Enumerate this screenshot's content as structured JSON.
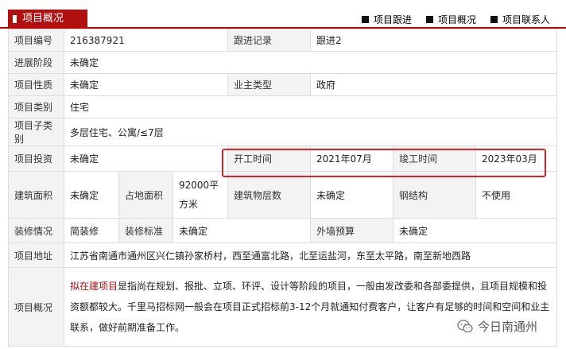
{
  "header": {
    "title": "项目概况",
    "nav": [
      "项目跟进",
      "项目概况",
      "项目联系人"
    ]
  },
  "rows": {
    "code_label": "项目编号",
    "code_value": "216387921",
    "follow_label": "跟进记录",
    "follow_value": "跟进2",
    "stage_label": "进展阶段",
    "stage_value": "未确定",
    "nature_label": "项目性质",
    "nature_value": "未确定",
    "owner_type_label": "业主类型",
    "owner_type_value": "政府",
    "category_label": "项目类别",
    "category_value": "住宅",
    "subcategory_label": "项目子类别",
    "subcategory_value": "多层住宅、公寓/≤7层",
    "investment_label": "项目投资",
    "investment_value": "未确定",
    "start_label": "开工时间",
    "start_value": "2021年07月",
    "finish_label": "竣工时间",
    "finish_value": "2023年03月",
    "building_area_label": "建筑面积",
    "building_area_value": "未确定",
    "land_area_label": "占地面积",
    "land_area_value": "92000平方米",
    "floors_label": "建筑物层数",
    "floors_value": "未确定",
    "steel_label": "钢结构",
    "steel_value": "不使用",
    "decor_label": "装修情况",
    "decor_value": "简装修",
    "decor_std_label": "装修标准",
    "decor_std_value": "未确定",
    "wall_budget_label": "外墙预算",
    "wall_budget_value": "未确定",
    "address_label": "项目地址",
    "address_value": "江苏省南通市通州区兴仁镇孙家桥村，西至通富北路，北至运盐河，东至太平路，南至新地西路",
    "overview_label": "项目概况",
    "overview_highlight": "拟在建项目",
    "overview_text": "是指尚在规划、报批、立项、环评、设计等阶段的项目，一般由发改委和各部委提供，且项目规模和投资额都较大。千里马招标网一般会在项目正式招标前3-12个月就通知付费客户，让客户有足够的时间和空间和业主联系，做好前期准备工作。"
  },
  "watermark": {
    "text": "今日南通州",
    "icon": "wechat-icon"
  },
  "colors": {
    "accent": "#b01010",
    "highlight_border": "#e02020",
    "label_bg": "#f3f3f3"
  }
}
